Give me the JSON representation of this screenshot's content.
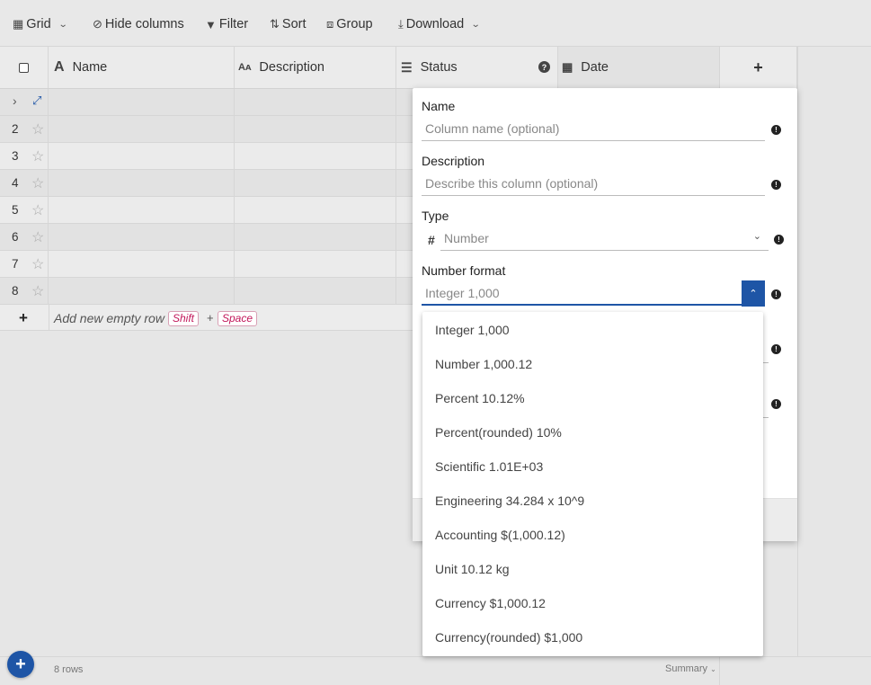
{
  "toolbar": {
    "grid": "Grid",
    "hide_columns": "Hide columns",
    "filter": "Filter",
    "sort": "Sort",
    "group": "Group",
    "download": "Download"
  },
  "columns": {
    "name": "Name",
    "description": "Description",
    "status": "Status",
    "date": "Date",
    "add": "+"
  },
  "rows": [
    "2",
    "3",
    "4",
    "5",
    "6",
    "7",
    "8"
  ],
  "add_row": {
    "plus": "+",
    "label": "Add new empty row",
    "key1": "Shift",
    "key_join": "+",
    "key2": "Space"
  },
  "footer": {
    "row_count": "8 rows",
    "summary": "Summary"
  },
  "modal": {
    "name_label": "Name",
    "name_placeholder": "Column name (optional)",
    "description_label": "Description",
    "description_placeholder": "Describe this column (optional)",
    "type_label": "Type",
    "type_icon": "#",
    "type_value": "Number",
    "format_label": "Number format",
    "format_value": "Integer 1,000"
  },
  "format_options": [
    "Integer 1,000",
    "Number 1,000.12",
    "Percent 10.12%",
    "Percent(rounded) 10%",
    "Scientific 1.01E+03",
    "Engineering 34.284 x 10^9",
    "Accounting $(1,000.12)",
    "Unit 10.12 kg",
    "Currency $1,000.12",
    "Currency(rounded) $1,000"
  ],
  "colors": {
    "accent": "#1e55a6",
    "kbd_text": "#c2185b"
  }
}
